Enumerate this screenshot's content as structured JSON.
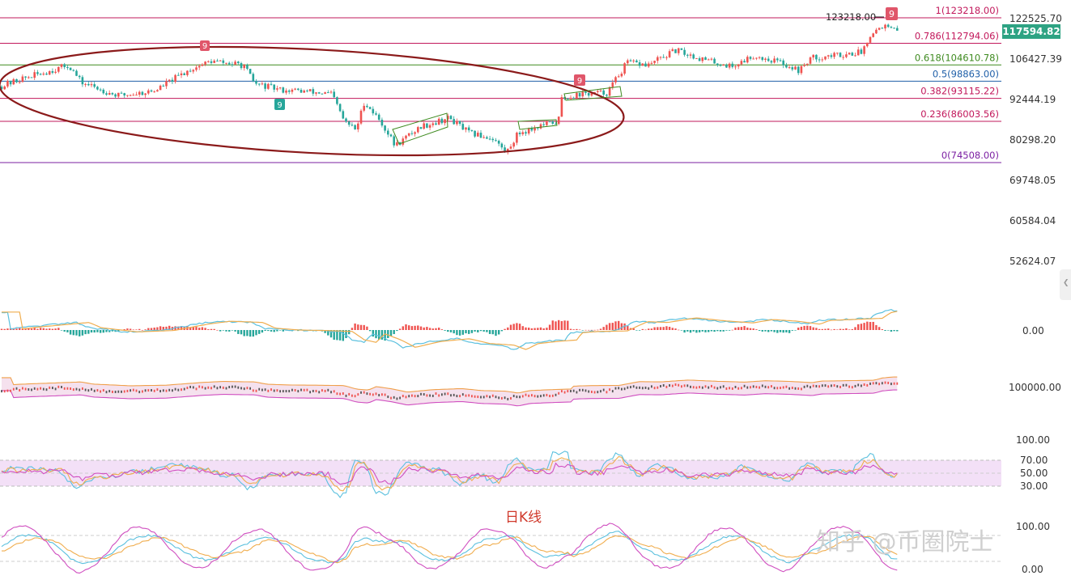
{
  "chart_data": [
    {
      "type": "candlestick",
      "panel": "price",
      "high_label": "123218.00",
      "last_price": "117594.82",
      "y_tick_labels": [
        "122525.70",
        "106427.39",
        "92444.19",
        "80298.20",
        "69748.05",
        "60584.04",
        "52624.07"
      ],
      "fib_levels": [
        {
          "label": "1(123218.00)",
          "value": 123218.0,
          "color": "#c2185b"
        },
        {
          "label": "0.786(112794.06)",
          "value": 112794.06,
          "color": "#c2185b"
        },
        {
          "label": "0.618(104610.78)",
          "value": 104610.78,
          "color": "#3e8a1f"
        },
        {
          "label": "0.5(98863.00)",
          "value": 98863.0,
          "color": "#1f5fa8"
        },
        {
          "label": "0.382(93115.22)",
          "value": 93115.22,
          "color": "#c2185b"
        },
        {
          "label": "0.236(86003.56)",
          "value": 86003.56,
          "color": "#c2185b"
        },
        {
          "label": "0(74508.00)",
          "value": 74508.0,
          "color": "#7b1fa2"
        }
      ],
      "td_markers": [
        "9",
        "9",
        "9",
        "9"
      ],
      "annotation": "日K线",
      "watermark": "知乎 @币圈院士",
      "up_color": "#ef5350",
      "down_color": "#26a69a",
      "profile": [
        [
          0,
          97000
        ],
        [
          25,
          99500
        ],
        [
          50,
          101500
        ],
        [
          85,
          104500
        ],
        [
          100,
          98500
        ],
        [
          145,
          94000
        ],
        [
          190,
          95500
        ],
        [
          235,
          103000
        ],
        [
          260,
          106000
        ],
        [
          300,
          104500
        ],
        [
          315,
          98000
        ],
        [
          345,
          96000
        ],
        [
          375,
          95500
        ],
        [
          410,
          94500
        ],
        [
          425,
          86000
        ],
        [
          440,
          83500
        ],
        [
          450,
          92000
        ],
        [
          470,
          86000
        ],
        [
          488,
          79000
        ],
        [
          520,
          84500
        ],
        [
          555,
          87000
        ],
        [
          580,
          82500
        ],
        [
          610,
          81000
        ],
        [
          625,
          77000
        ],
        [
          640,
          82500
        ],
        [
          665,
          84500
        ],
        [
          690,
          86000
        ],
        [
          692,
          93000
        ],
        [
          715,
          94500
        ],
        [
          750,
          95000
        ],
        [
          775,
          105500
        ],
        [
          800,
          104500
        ],
        [
          835,
          110000
        ],
        [
          870,
          106500
        ],
        [
          905,
          104000
        ],
        [
          930,
          108000
        ],
        [
          960,
          106000
        ],
        [
          988,
          102500
        ],
        [
          1000,
          107000
        ],
        [
          1040,
          108500
        ],
        [
          1065,
          109500
        ],
        [
          1075,
          116500
        ],
        [
          1090,
          120000
        ],
        [
          1100,
          118500
        ],
        [
          1110,
          117500
        ]
      ]
    },
    {
      "type": "histogram",
      "panel": "macd",
      "zero_label": "0.00"
    },
    {
      "type": "line",
      "panel": "bands",
      "level_label": "100000.00"
    },
    {
      "type": "line",
      "panel": "rsi",
      "tick_labels": [
        "100.00",
        "70.00",
        "50.00",
        "30.00"
      ]
    },
    {
      "type": "line",
      "panel": "kdj",
      "tick_labels": [
        "100.00",
        "0.00"
      ]
    }
  ]
}
